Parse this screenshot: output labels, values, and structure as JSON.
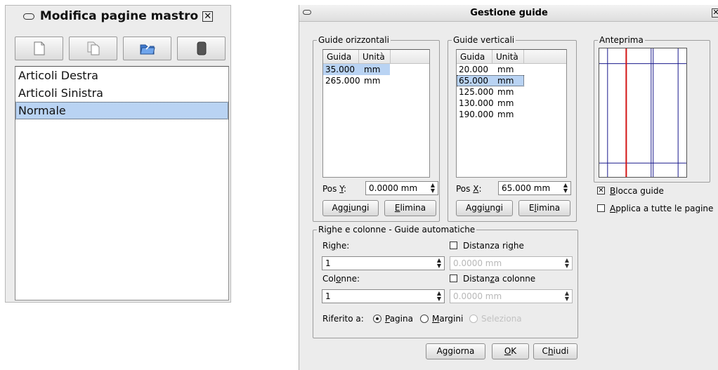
{
  "master_pages": {
    "title": "Modifica pagine mastro",
    "close_glyph": "☒",
    "toolbar": [
      "new-page-icon",
      "duplicate-page-icon",
      "import-page-icon",
      "delete-page-icon"
    ],
    "items": [
      "Articoli Destra",
      "Articoli Sinistra",
      "Normale"
    ],
    "selected_index": 2
  },
  "guides": {
    "title": "Gestione guide",
    "close_glyph": "☒",
    "horizontal": {
      "group_title": "Guide orizzontali",
      "col_guide": "Guida",
      "col_unit": "Unità",
      "rows": [
        {
          "value": "35.000",
          "unit": "mm"
        },
        {
          "value": "265.000",
          "unit": "mm"
        }
      ],
      "selected_index": 0,
      "pos_label_pre": "Pos ",
      "pos_label_key": "Y",
      "pos_label_post": ":",
      "pos_value": "0.0000 mm",
      "add_pre": "Agg",
      "add_key": "i",
      "add_post": "ungi",
      "del_pre": "",
      "del_key": "E",
      "del_post": "limina"
    },
    "vertical": {
      "group_title": "Guide verticali",
      "col_guide": "Guida",
      "col_unit": "Unità",
      "rows": [
        {
          "value": "20.000",
          "unit": "mm"
        },
        {
          "value": "65.000",
          "unit": "mm"
        },
        {
          "value": "125.000",
          "unit": "mm"
        },
        {
          "value": "130.000",
          "unit": "mm"
        },
        {
          "value": "190.000",
          "unit": "mm"
        }
      ],
      "selected_index": 1,
      "pos_label_pre": "Pos ",
      "pos_label_key": "X",
      "pos_label_post": ":",
      "pos_value": "65.000 mm",
      "add_pre": "Aggi",
      "add_key": "u",
      "add_post": "ngi",
      "del_pre": "E",
      "del_key": "l",
      "del_post": "imina"
    },
    "preview": {
      "group_title": "Anteprima",
      "guide_color": "#1a1a8c",
      "selected_guide_color": "#d41414"
    },
    "lock": {
      "checked": true,
      "pre": "",
      "key": "B",
      "post": "locca guide"
    },
    "apply_all": {
      "checked": false,
      "pre": "",
      "key": "A",
      "post": "pplica a tutte le pagine"
    },
    "auto": {
      "group_title": "Righe e colonne - Guide automatiche",
      "rows_pre": "Ri",
      "rows_key": "g",
      "rows_post": "he:",
      "rows_value": "1",
      "rows_gap_pre": "Distanza ri",
      "rows_gap_key": "g",
      "rows_gap_post": "he",
      "rows_gap_value": "0.0000 mm",
      "cols_pre": "Col",
      "cols_key": "o",
      "cols_post": "nne:",
      "cols_value": "1",
      "cols_gap_pre": "Distan",
      "cols_gap_key": "z",
      "cols_gap_post": "a colonne",
      "cols_gap_value": "0.0000 mm",
      "ref_label": "Riferito a:",
      "ref_page_pre": "",
      "ref_page_key": "P",
      "ref_page_post": "agina",
      "ref_margins_pre": "",
      "ref_margins_key": "M",
      "ref_margins_post": "argini",
      "ref_selection": "Seleziona",
      "selected_ref": "Pagina"
    },
    "footer": {
      "update": "Aggiorna",
      "ok_key": "O",
      "ok_post": "K",
      "close_pre": "C",
      "close_key": "h",
      "close_post": "iudi"
    }
  }
}
